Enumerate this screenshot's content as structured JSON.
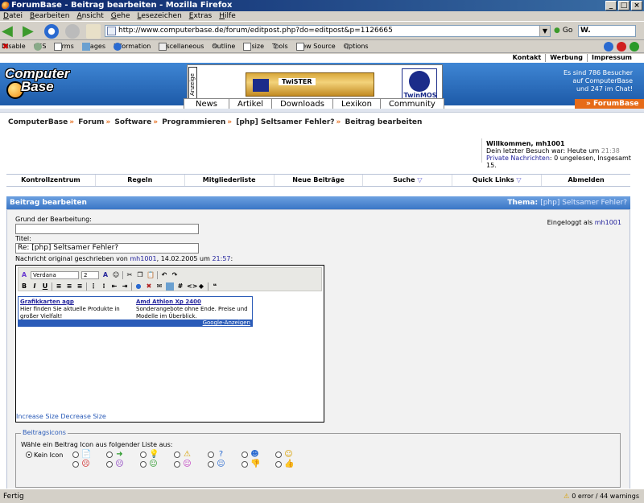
{
  "window": {
    "title": "ForumBase - Beitrag bearbeiten - Mozilla Firefox"
  },
  "menubar": [
    "Datei",
    "Bearbeiten",
    "Ansicht",
    "Gehe",
    "Lesezeichen",
    "Extras",
    "Hilfe"
  ],
  "navigation": {
    "url": "http://www.computerbase.de/forum/editpost.php?do=editpost&p=1126665",
    "go_label": "Go",
    "search_value": "W."
  },
  "devbar": {
    "items": [
      "Disable",
      "CSS",
      "Forms",
      "Images",
      "Information",
      "Miscellaneous",
      "Outline",
      "Resize",
      "Tools",
      "View Source",
      "Options"
    ]
  },
  "site": {
    "toplinks": [
      "Kontakt",
      "Werbung",
      "Impressum"
    ],
    "logo_line1": "Computer",
    "logo_line2": "Base",
    "ad_label": "Anzeige",
    "ad_product": "TwiSTER",
    "ad_brand": "TwinMOS",
    "visitors": "Es sind 786 Besucher auf ComputerBase und 247 im Chat!",
    "tabs": [
      "News",
      "Artikel",
      "Downloads",
      "Lexikon",
      "Community"
    ],
    "forumbase_tab": "» ForumBase"
  },
  "breadcrumb": [
    "ComputerBase",
    "Forum",
    "Software",
    "Programmieren",
    "[php] Seltsamer Fehler?",
    "Beitrag bearbeiten"
  ],
  "welcome": {
    "heading": "Willkommen, mh1001",
    "last_visit_prefix": "Dein letzter Besuch war: Heute um",
    "last_visit_time": "21:38",
    "pm_link": "Private Nachrichten",
    "pm_text": ": 0 ungelesen, Insgesamt 15."
  },
  "forumnav": [
    "Kontrollzentrum",
    "Regeln",
    "Mitgliederliste",
    "Neue Beiträge",
    "Suche",
    "Quick Links",
    "Abmelden"
  ],
  "panel": {
    "title": "Beitrag bearbeiten",
    "thema_label": "Thema:",
    "thema_value": "[php] Seltsamer Fehler?",
    "logged_in_prefix": "Eingeloggt als",
    "logged_in_user": "mh1001",
    "reason_label": "Grund der Bearbeitung:",
    "reason_value": "",
    "title_label": "Titel:",
    "title_value": "Re: [php] Seltsamer Fehler?",
    "orig_prefix": "Nachricht original geschrieben von",
    "orig_user": "mh1001",
    "orig_date": ", 14.02.2005 um",
    "orig_time": "21:57",
    "orig_suffix": ":"
  },
  "editor": {
    "font": "Verdana",
    "size": "2",
    "ads": [
      {
        "title": "Grafikkarten agp",
        "text": "Hier finden Sie aktuelle Produkte in großer Vielfalt!"
      },
      {
        "title": "Amd Athlon Xp 2400",
        "text": "Sonderangebote ohne Ende. Preise und Modelle im Überblick."
      }
    ],
    "ads_footer": "Google-Anzeigen",
    "increase": "Increase Size",
    "decrease": "Decrease Size"
  },
  "icons": {
    "legend": "Beitragsicons",
    "intro": "Wähle ein Beitrag Icon aus folgender Liste aus:",
    "none_label": "Kein Icon"
  },
  "status": {
    "left": "Fertig",
    "right": "0 error / 44 warnings"
  }
}
